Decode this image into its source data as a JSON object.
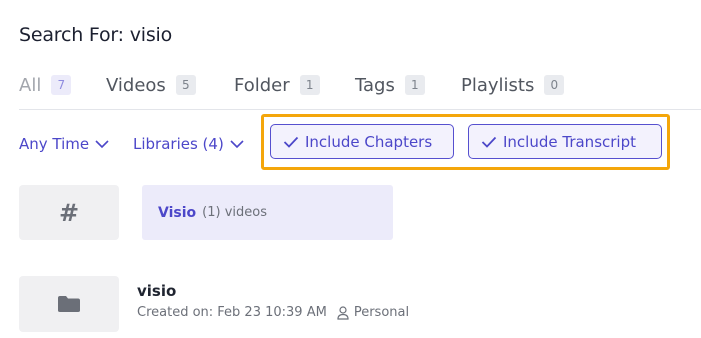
{
  "header": {
    "title": "Search For: visio"
  },
  "tabs": [
    {
      "label": "All",
      "count": "7",
      "active": true
    },
    {
      "label": "Videos",
      "count": "5"
    },
    {
      "label": "Folder",
      "count": "1"
    },
    {
      "label": "Tags",
      "count": "1"
    },
    {
      "label": "Playlists",
      "count": "0"
    }
  ],
  "filters": {
    "time": "Any Time",
    "libraries": "Libraries (4)",
    "include_chapters": "Include Chapters",
    "include_transcript": "Include Transcript",
    "highlight_color": "#f4a60a"
  },
  "results": {
    "tag": {
      "icon": "#",
      "name": "Visio",
      "count": "(1) videos"
    },
    "folder": {
      "title": "visio",
      "created": "Created on: Feb 23 10:39 AM",
      "owner": "Personal"
    }
  },
  "colors": {
    "accent": "#4c47c9",
    "chip_bg": "#f3f2fd",
    "tag_bg": "#ecebfa"
  }
}
